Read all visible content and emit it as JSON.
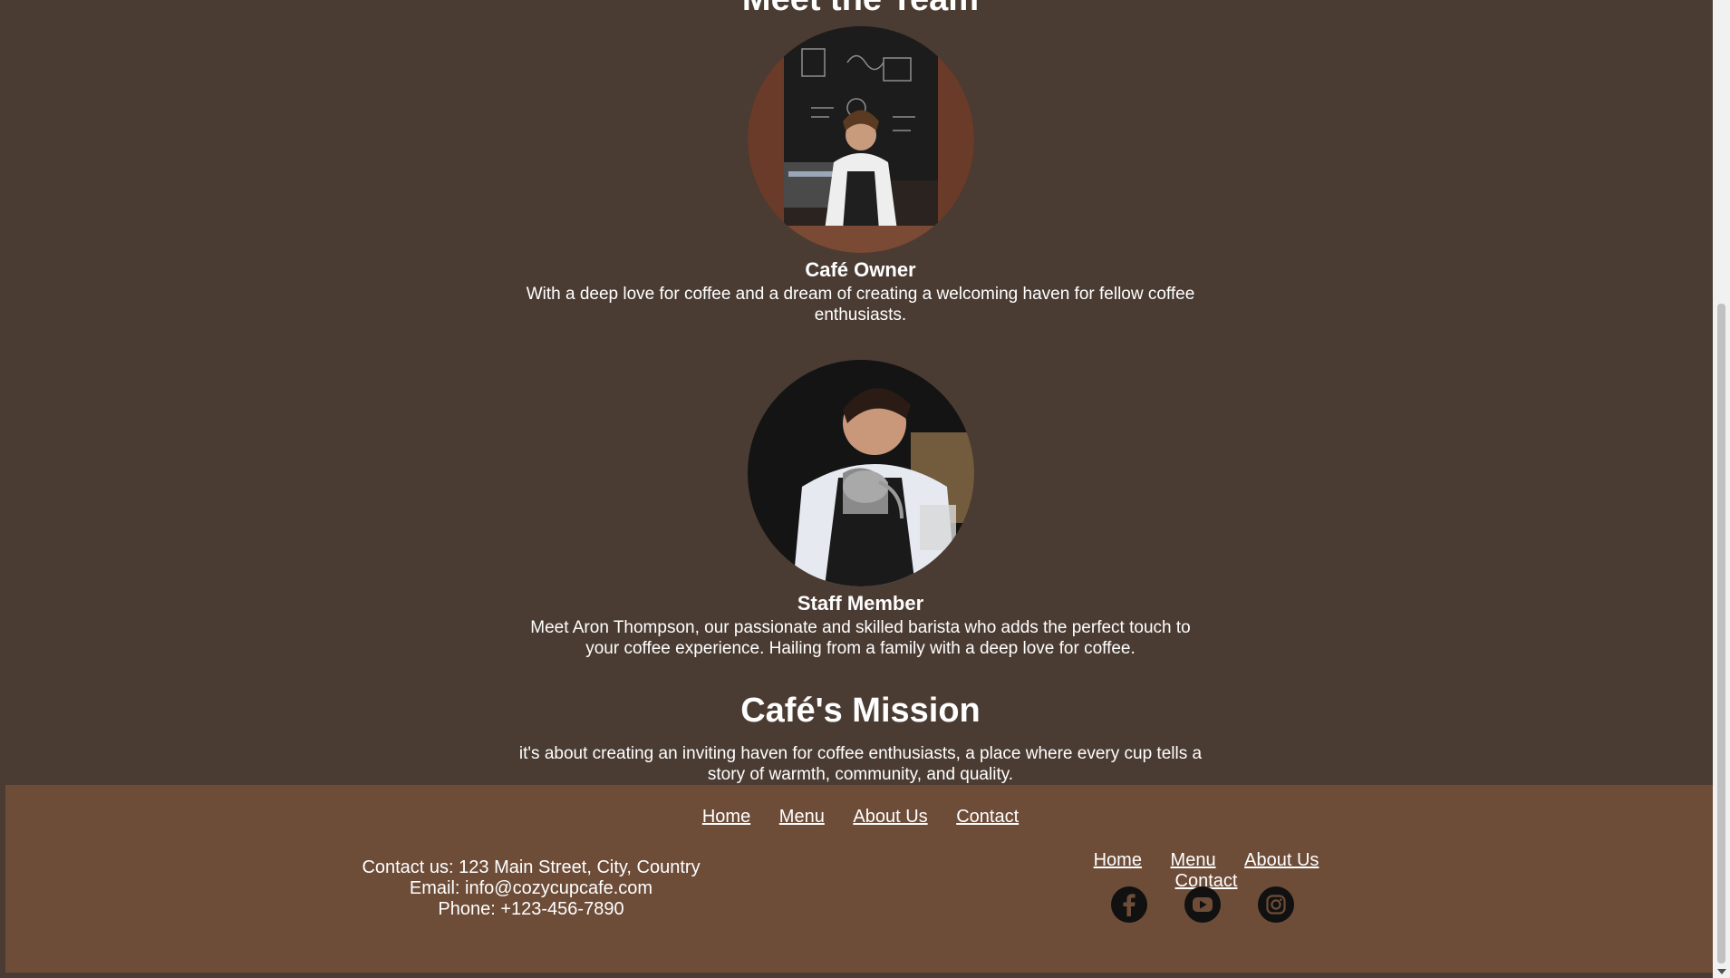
{
  "team": {
    "title": "Meet the Team",
    "members": [
      {
        "name": "Café Owner",
        "description": "With a deep love for coffee and a dream of creating a welcoming haven for fellow coffee enthusiasts."
      },
      {
        "name": "Staff Member",
        "description": "Meet Aron Thompson, our passionate and skilled barista who adds the perfect touch to your coffee experience. Hailing from a family with a deep love for coffee."
      }
    ]
  },
  "mission": {
    "title": "Café's Mission",
    "text": "it's about creating an inviting haven for coffee enthusiasts, a place where every cup tells a story of warmth, community, and quality."
  },
  "footer": {
    "nav_top": [
      "Home",
      "Menu",
      "About Us",
      "Contact"
    ],
    "contact": {
      "address": "Contact us: 123 Main Street, City, Country",
      "email": "Email: info@cozycupcafe.com",
      "phone": "Phone: +123-456-7890"
    },
    "nav_right": [
      "Home",
      "Menu",
      "About Us",
      "Contact"
    ],
    "socials": [
      "facebook-icon",
      "youtube-icon",
      "instagram-icon"
    ]
  },
  "colors": {
    "page_background": "#4b3c33",
    "footer_background": "#6d4c38",
    "text": "#ffffff",
    "social_icon": "#111111"
  }
}
